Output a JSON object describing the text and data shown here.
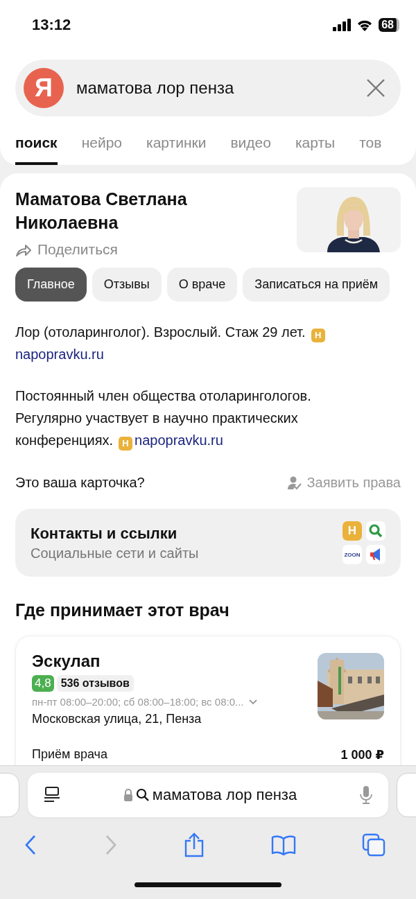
{
  "status_bar": {
    "time": "13:12",
    "battery": "68"
  },
  "search": {
    "logo": "Я",
    "value": "маматова лор пенза"
  },
  "tabs": [
    {
      "label": "поиск",
      "selected": true
    },
    {
      "label": "нейро",
      "selected": false
    },
    {
      "label": "картинки",
      "selected": false
    },
    {
      "label": "видео",
      "selected": false
    },
    {
      "label": "карты",
      "selected": false
    },
    {
      "label": "тов",
      "selected": false
    }
  ],
  "profile": {
    "name": "Маматова Светлана Николаевна",
    "share": "Поделиться",
    "chips": [
      {
        "label": "Главное",
        "selected": true
      },
      {
        "label": "Отзывы",
        "selected": false
      },
      {
        "label": "О враче",
        "selected": false
      },
      {
        "label": "Записаться на приём",
        "selected": false
      }
    ],
    "paragraphs": [
      {
        "text": "Лор (отоларинголог). Взрослый. Стаж 29 лет.",
        "source_badge": "Н",
        "source": "napopravku.ru"
      },
      {
        "text": "Постоянный член общества отоларингологов. Регулярно участвует в научно практических конференциях.",
        "source_badge": "Н",
        "source": "napopravku.ru"
      }
    ],
    "claim_question": "Это ваша карточка?",
    "claim_link": "Заявить права"
  },
  "contacts": {
    "title": "Контакты и ссылки",
    "subtitle": "Социальные сети и сайты",
    "badge_letter": "Н",
    "zoon": "ZOON"
  },
  "clinics": {
    "heading": "Где принимает этот врач",
    "items": [
      {
        "name": "Эскулап",
        "rating": "4,8",
        "reviews": "536 отзывов",
        "hours": "пн-пт 08:00–20:00; сб 08:00–18:00; вс 08:0...",
        "address": "Московская улица, 21, Пенза",
        "service": "Приём врача",
        "price": "1 000 ₽"
      }
    ]
  },
  "browser": {
    "address": "маматова лор пенза",
    "nav": [
      {
        "kind": "back",
        "disabled": false
      },
      {
        "kind": "forward",
        "disabled": true
      },
      {
        "kind": "share",
        "disabled": false
      },
      {
        "kind": "bookmarks",
        "disabled": false
      },
      {
        "kind": "tabs",
        "disabled": false
      }
    ]
  }
}
